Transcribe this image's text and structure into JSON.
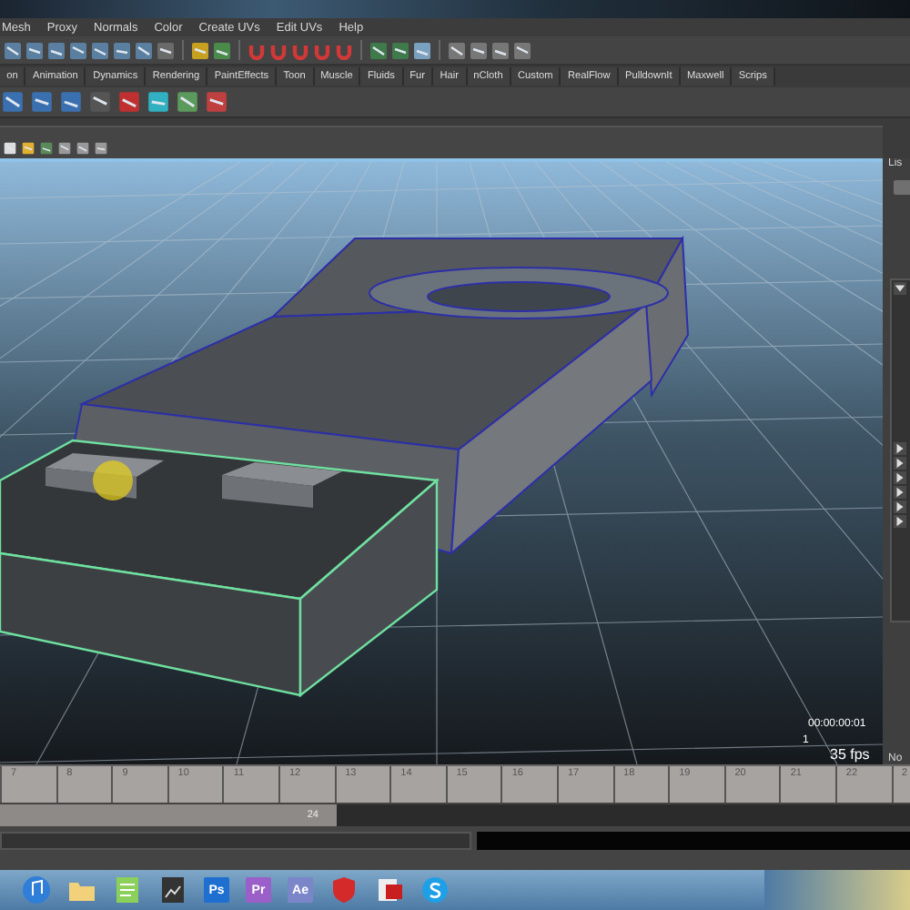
{
  "menu": [
    "Mesh",
    "Proxy",
    "Normals",
    "Color",
    "Create UVs",
    "Edit UVs",
    "Help"
  ],
  "shelf_tabs": [
    "on",
    "Animation",
    "Dynamics",
    "Rendering",
    "PaintEffects",
    "Toon",
    "Muscle",
    "Fluids",
    "Fur",
    "Hair",
    "nCloth",
    "Custom",
    "RealFlow",
    "PulldownIt",
    "Maxwell",
    "Scrips"
  ],
  "viewport_hud": {
    "timecode": "00:00:00:01",
    "frame": "1",
    "fps": "35 fps"
  },
  "right_panel": {
    "label": "Lis",
    "bottom_label": "No"
  },
  "time_slider": {
    "frames": [
      "7",
      "8",
      "9",
      "10",
      "11",
      "12",
      "13",
      "14",
      "15",
      "16",
      "17",
      "18",
      "19",
      "20",
      "21",
      "22",
      "2"
    ]
  },
  "range_slider": {
    "end": "24",
    "level": 0.37
  },
  "taskbar": {
    "apps": [
      {
        "kind": "music"
      },
      {
        "kind": "folder"
      },
      {
        "kind": "notepad"
      },
      {
        "kind": "image"
      },
      {
        "kind": "adobe",
        "label": "Ps",
        "color": "#1f6fd0"
      },
      {
        "kind": "adobe",
        "label": "Pr",
        "color": "#9a5fc8"
      },
      {
        "kind": "adobe",
        "label": "Ae",
        "color": "#7a86c8"
      },
      {
        "kind": "shield"
      },
      {
        "kind": "acrobat"
      },
      {
        "kind": "skype"
      }
    ]
  }
}
